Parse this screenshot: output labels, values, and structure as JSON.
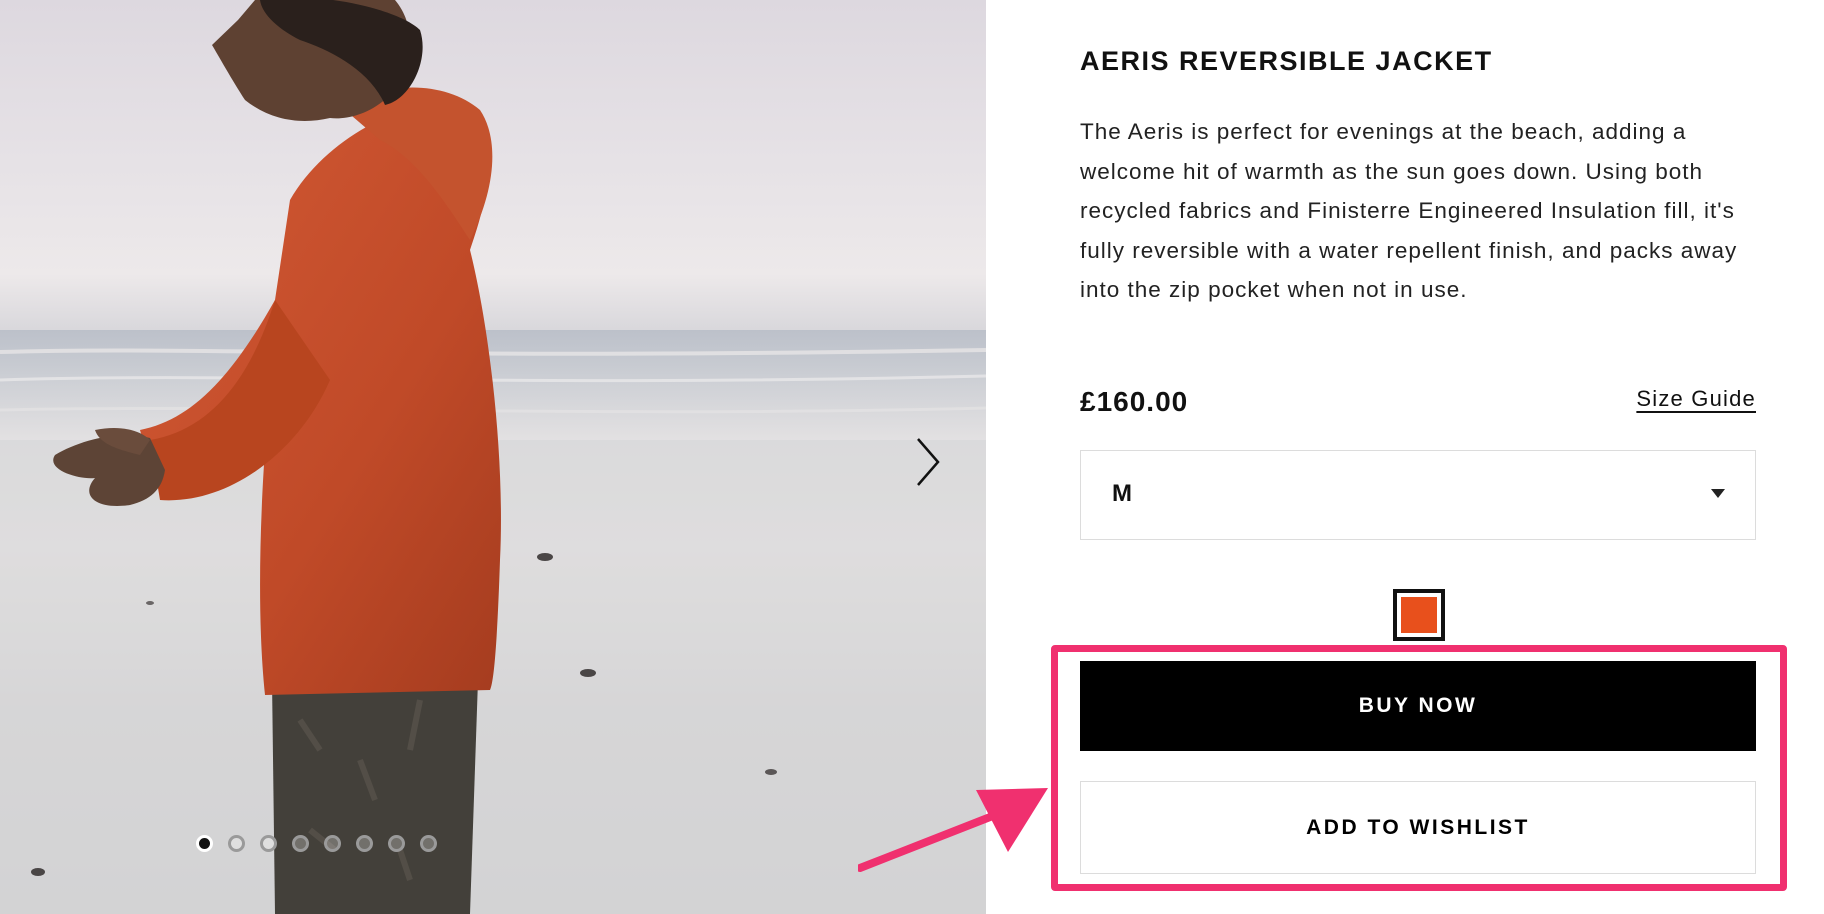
{
  "gallery": {
    "image_alt": "Man wearing an orange hooded jacket standing on a beach at dusk",
    "next_icon": "chevron-right-icon",
    "slide_count": 8,
    "active_slide": 1
  },
  "product": {
    "title": "AERIS REVERSIBLE JACKET",
    "description": "The Aeris is perfect for evenings at the beach, adding a welcome hit of warmth as the sun goes down. Using both recycled fabrics and Finisterre Engineered Insulation fill, it's fully reversible with a water repellent finish, and packs away into the zip pocket when not in use.",
    "price": "£160.00",
    "size_guide_label": "Size Guide",
    "selected_size": "M",
    "size_select_icon": "caret-down-icon",
    "color_swatch": {
      "color": "#e8501c",
      "selected": true
    },
    "buy_now_label": "BUY NOW",
    "wishlist_label": "ADD TO WISHLIST"
  },
  "annotation": {
    "color": "#f0306f",
    "arrow_icon": "arrow-icon"
  }
}
